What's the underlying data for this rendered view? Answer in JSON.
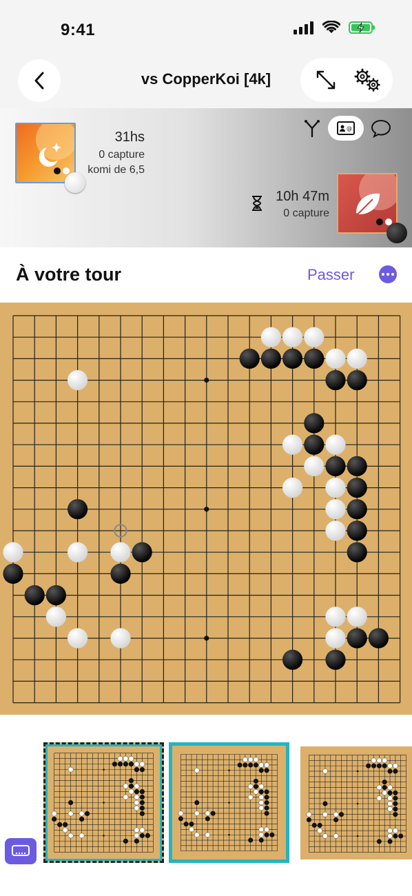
{
  "status_bar": {
    "time": "9:41"
  },
  "header": {
    "title": "vs CopperKoi [4k]"
  },
  "player_me": {
    "time": "31hs",
    "captures": "0 capture",
    "komi": "komi de 6,5"
  },
  "player_opponent": {
    "time": "10h 47m",
    "captures": "0 capture"
  },
  "turn": {
    "label": "À votre tour",
    "pass_label": "Passer"
  },
  "colors": {
    "accent": "#6b5be0",
    "board": "#dcb06a",
    "highlight": "#22b5c0"
  },
  "icons": {
    "back": "chevron-left-icon",
    "expand": "expand-arrows-icon",
    "settings": "gears-icon",
    "fork": "fork-icon",
    "id_card": "id-card-icon",
    "chat": "chat-bubble-icon",
    "hourglass": "hourglass-icon",
    "more": "more-dots-icon",
    "keyboard": "keyboard-icon"
  },
  "board": {
    "size": 19,
    "black_stones": [
      [
        11,
        2
      ],
      [
        12,
        2
      ],
      [
        13,
        2
      ],
      [
        14,
        2
      ],
      [
        15,
        3
      ],
      [
        16,
        3
      ],
      [
        14,
        5
      ],
      [
        14,
        6
      ],
      [
        15,
        7
      ],
      [
        16,
        7
      ],
      [
        16,
        8
      ],
      [
        16,
        9
      ],
      [
        16,
        10
      ],
      [
        16,
        11
      ],
      [
        3,
        9
      ],
      [
        6,
        11
      ],
      [
        0,
        12
      ],
      [
        5,
        12
      ],
      [
        1,
        13
      ],
      [
        2,
        13
      ],
      [
        16,
        15
      ],
      [
        17,
        15
      ],
      [
        13,
        16
      ],
      [
        15,
        16
      ]
    ],
    "white_stones": [
      [
        12,
        1
      ],
      [
        13,
        1
      ],
      [
        14,
        1
      ],
      [
        15,
        2
      ],
      [
        16,
        2
      ],
      [
        3,
        3
      ],
      [
        13,
        6
      ],
      [
        15,
        6
      ],
      [
        14,
        7
      ],
      [
        13,
        8
      ],
      [
        15,
        8
      ],
      [
        15,
        9
      ],
      [
        15,
        10
      ],
      [
        0,
        11
      ],
      [
        3,
        11
      ],
      [
        5,
        11
      ],
      [
        2,
        14
      ],
      [
        3,
        15
      ],
      [
        5,
        15
      ],
      [
        15,
        14
      ],
      [
        16,
        14
      ],
      [
        15,
        15
      ]
    ],
    "last_move": [
      5,
      10
    ],
    "star_points": [
      [
        9,
        3
      ],
      [
        9,
        9
      ],
      [
        9,
        15
      ]
    ]
  }
}
